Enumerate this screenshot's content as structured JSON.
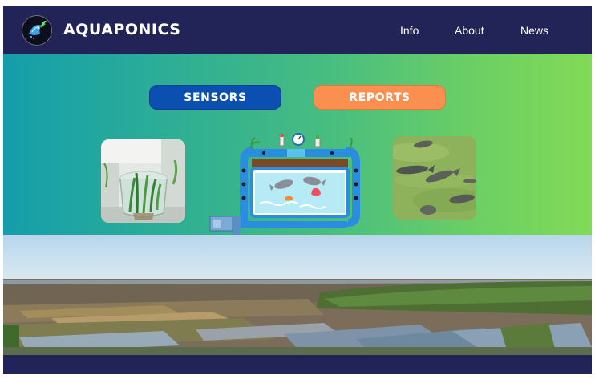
{
  "header": {
    "brand": "AQUAPONICS",
    "logo_icon": "fish-logo-icon",
    "nav": [
      {
        "label": "Info"
      },
      {
        "label": "About"
      },
      {
        "label": "News"
      }
    ]
  },
  "hero": {
    "buttons": {
      "sensors_label": "SENSORS",
      "reports_label": "REPORTS"
    },
    "images": [
      {
        "name": "plants-in-jar-photo"
      },
      {
        "name": "aquaponics-system-illustration"
      },
      {
        "name": "fish-in-water-photo"
      }
    ]
  },
  "colors": {
    "header_bg": "#222457",
    "sensors_button": "#0b4fb0",
    "reports_button": "#fb8f4f",
    "gradient_start": "#149eab",
    "gradient_end": "#82da56"
  }
}
